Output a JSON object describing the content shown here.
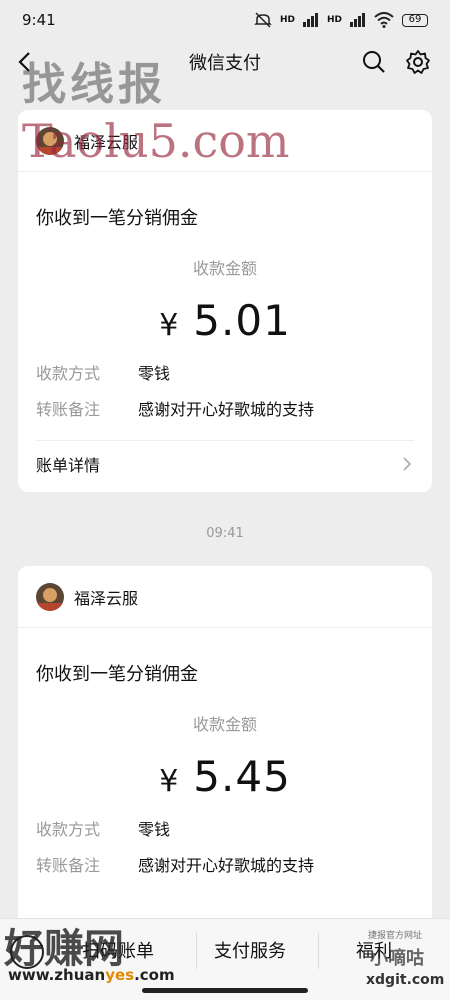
{
  "status_bar": {
    "time": "9:41",
    "network_1": "HD",
    "network_2": "HD",
    "battery": "69"
  },
  "nav": {
    "title": "微信支付"
  },
  "messages": [
    {
      "sender": "福泽云服",
      "title": "你收到一笔分销佣金",
      "amount_label": "收款金额",
      "currency": "¥",
      "amount": "5.01",
      "method_key": "收款方式",
      "method_value": "零钱",
      "note_key": "转账备注",
      "note_value": "感谢对开心好歌城的支持",
      "detail_label": "账单详情"
    },
    {
      "sender": "福泽云服",
      "title": "你收到一笔分销佣金",
      "amount_label": "收款金额",
      "currency": "¥",
      "amount": "5.45",
      "method_key": "收款方式",
      "method_value": "零钱",
      "note_key": "转账备注",
      "note_value": "感谢对开心好歌城的支持"
    }
  ],
  "time_separator": "09:41",
  "bottom_bar": {
    "item_1": "扫码账单",
    "item_2": "支付服务",
    "item_3": "福利"
  },
  "watermarks": {
    "top": "找线报",
    "taolu": "Taolu5.com",
    "bottom_left": "好赚网",
    "bottom_left_url_a": "www.zhuan",
    "bottom_left_url_b": "yes",
    "bottom_left_url_c": ".com",
    "bottom_right_small": "捷报官方网址",
    "bottom_right": "小嘀咕",
    "bottom_right_url": "xdgit.com"
  }
}
